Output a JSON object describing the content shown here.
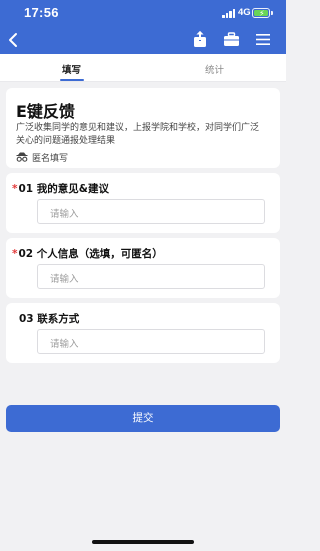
{
  "status_bar": {
    "time": "17:56",
    "network": "4G"
  },
  "tabs": [
    {
      "label": "填写",
      "active": true
    },
    {
      "label": "统计",
      "active": false
    }
  ],
  "form": {
    "title": "E键反馈",
    "description": "广泛收集同学的意见和建议，上报学院和学校，对同学们广泛关心的问题通报处理结果",
    "anonymous_label": "匿名填写",
    "questions": [
      {
        "number": "01",
        "label": "我的意见&建议",
        "required": true,
        "placeholder": "请输入"
      },
      {
        "number": "02",
        "label": "个人信息（选填，可匿名）",
        "required": true,
        "placeholder": "请输入"
      },
      {
        "number": "03",
        "label": "联系方式",
        "required": false,
        "placeholder": "请输入"
      }
    ],
    "submit_label": "提交"
  },
  "colors": {
    "primary": "#3d6bd3",
    "required_mark": "#e23a3a",
    "page_background": "#f1f1f3",
    "battery": "#69d457"
  },
  "icons": {
    "back": "chevron-left-icon",
    "share": "share-icon",
    "briefcase": "briefcase-icon",
    "menu": "hamburger-menu-icon",
    "anonymous": "incognito-glasses-icon"
  }
}
